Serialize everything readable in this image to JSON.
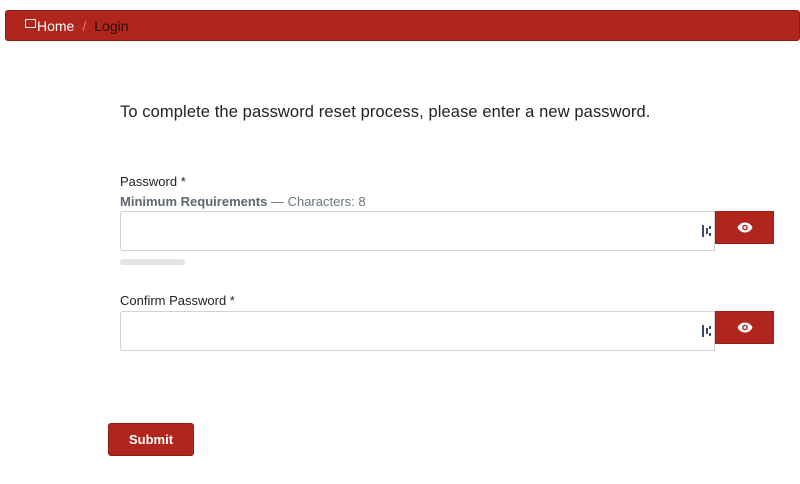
{
  "breadcrumb": {
    "home_label": "Home",
    "separator": "/",
    "current_label": "Login"
  },
  "intro_text": "To complete the password reset process, please enter a new password.",
  "password": {
    "label": "Password *",
    "requirements_title": "Minimum Requirements",
    "requirements_detail": " — Characters: 8",
    "value": "",
    "placeholder": "",
    "toggle_icon": "eye-icon",
    "strength": 0
  },
  "confirm_password": {
    "label": "Confirm Password *",
    "value": "",
    "placeholder": "",
    "toggle_icon": "eye-icon"
  },
  "submit_label": "Submit",
  "colors": {
    "accent": "#b0261c",
    "muted_text": "#6b7480",
    "field_border": "#cfd3d8"
  }
}
